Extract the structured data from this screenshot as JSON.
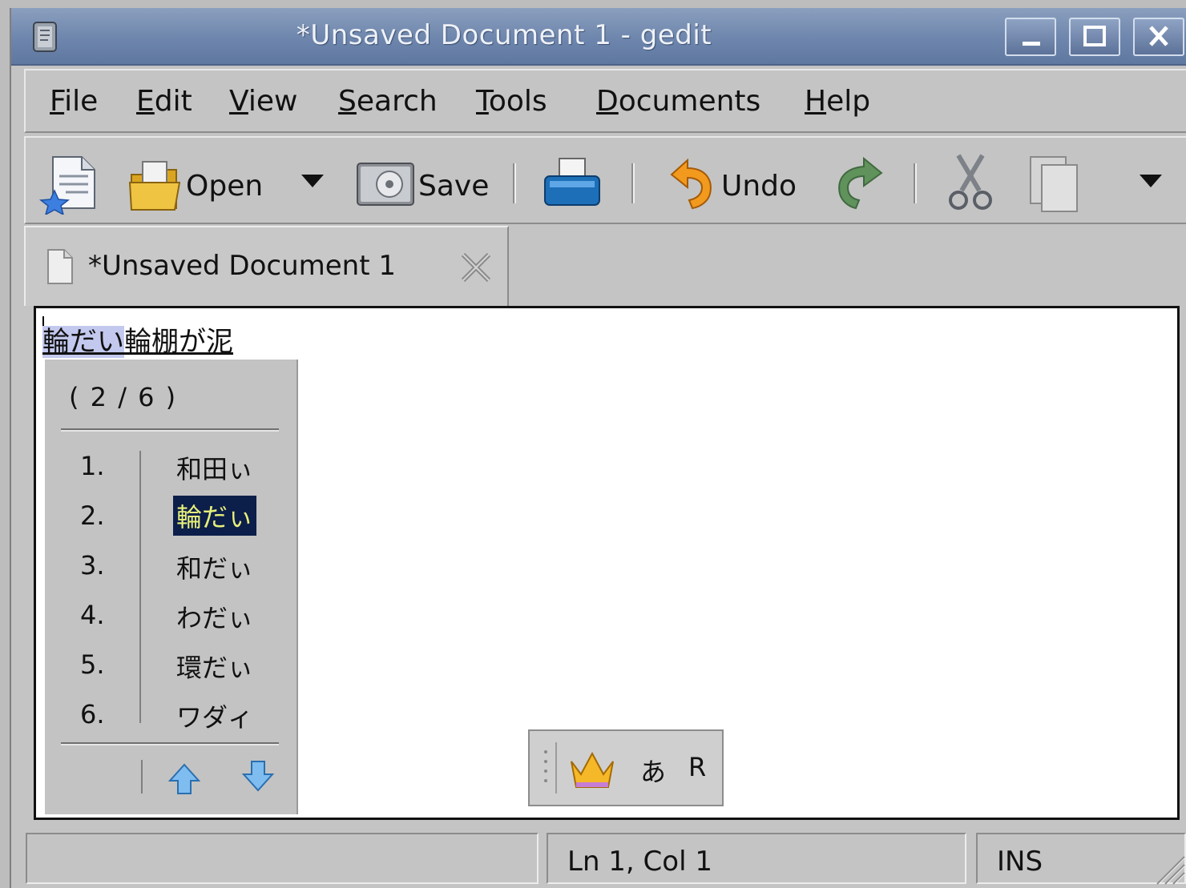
{
  "window": {
    "title": "*Unsaved Document 1 - gedit",
    "buttons": [
      "minimize",
      "maximize",
      "close"
    ]
  },
  "menubar": {
    "items": [
      {
        "mnemonic": "F",
        "rest": "ile"
      },
      {
        "mnemonic": "E",
        "rest": "dit"
      },
      {
        "mnemonic": "V",
        "rest": "iew"
      },
      {
        "mnemonic": "S",
        "rest": "earch"
      },
      {
        "mnemonic": "T",
        "rest": "ools"
      },
      {
        "mnemonic": "D",
        "rest": "ocuments"
      },
      {
        "mnemonic": "H",
        "rest": "elp"
      }
    ]
  },
  "toolbar": {
    "open_label": "Open",
    "save_label": "Save",
    "undo_label": "Undo",
    "icons": [
      "new-document-icon",
      "open-folder-icon",
      "dropdown-arrow-icon",
      "save-disk-icon",
      "print-icon",
      "undo-icon",
      "redo-icon",
      "cut-icon",
      "copy-icon",
      "overflow-arrow-icon"
    ]
  },
  "tab": {
    "label": "*Unsaved Document 1"
  },
  "editor": {
    "preedit_selected": "輪だい",
    "preedit_rest": "輪棚が泥"
  },
  "candidates": {
    "page": "( 2 / 6 )",
    "items": [
      {
        "num": "1.",
        "word": "和田ぃ"
      },
      {
        "num": "2.",
        "word": "輪だぃ"
      },
      {
        "num": "3.",
        "word": "和だぃ"
      },
      {
        "num": "4.",
        "word": "わだぃ"
      },
      {
        "num": "5.",
        "word": "環だぃ"
      },
      {
        "num": "6.",
        "word": "ワダィ"
      }
    ],
    "active_index": 1
  },
  "ime_status": {
    "mode_label": "あ",
    "input_label": "R"
  },
  "statusbar": {
    "position": "Ln 1, Col 1",
    "mode": "INS"
  },
  "colors": {
    "titlebar": "#6e86ad",
    "selection_preedit": "#c3c9ee",
    "candidate_active_bg": "#0c1e4a",
    "candidate_active_fg": "#e8f07a"
  }
}
